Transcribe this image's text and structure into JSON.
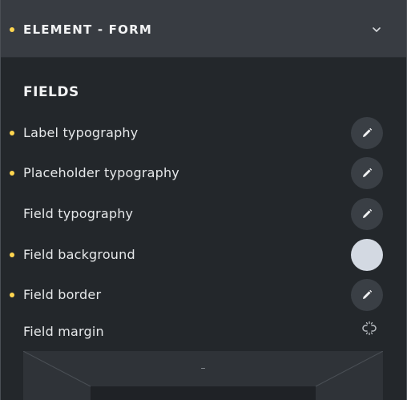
{
  "header": {
    "title": "ELEMENT - FORM",
    "chevron_icon": "chevron-down-icon"
  },
  "section": {
    "title": "FIELDS"
  },
  "rows": [
    {
      "label": "Label typography",
      "modified": true,
      "control": "edit",
      "icon": "pencil-icon"
    },
    {
      "label": "Placeholder typography",
      "modified": true,
      "control": "edit",
      "icon": "pencil-icon"
    },
    {
      "label": "Field typography",
      "modified": false,
      "control": "edit",
      "icon": "pencil-icon"
    },
    {
      "label": "Field background",
      "modified": true,
      "control": "color",
      "swatch_color": "#d3d9e2"
    },
    {
      "label": "Field border",
      "modified": true,
      "control": "edit",
      "icon": "pencil-icon"
    }
  ],
  "margin": {
    "label": "Field margin",
    "link_icon": "unlink-icon",
    "top_value": "–"
  },
  "colors": {
    "modified_dot": "#ffd64f",
    "header_bg": "#383c42",
    "panel_bg": "#23272b",
    "button_bg": "#3a3f45"
  }
}
